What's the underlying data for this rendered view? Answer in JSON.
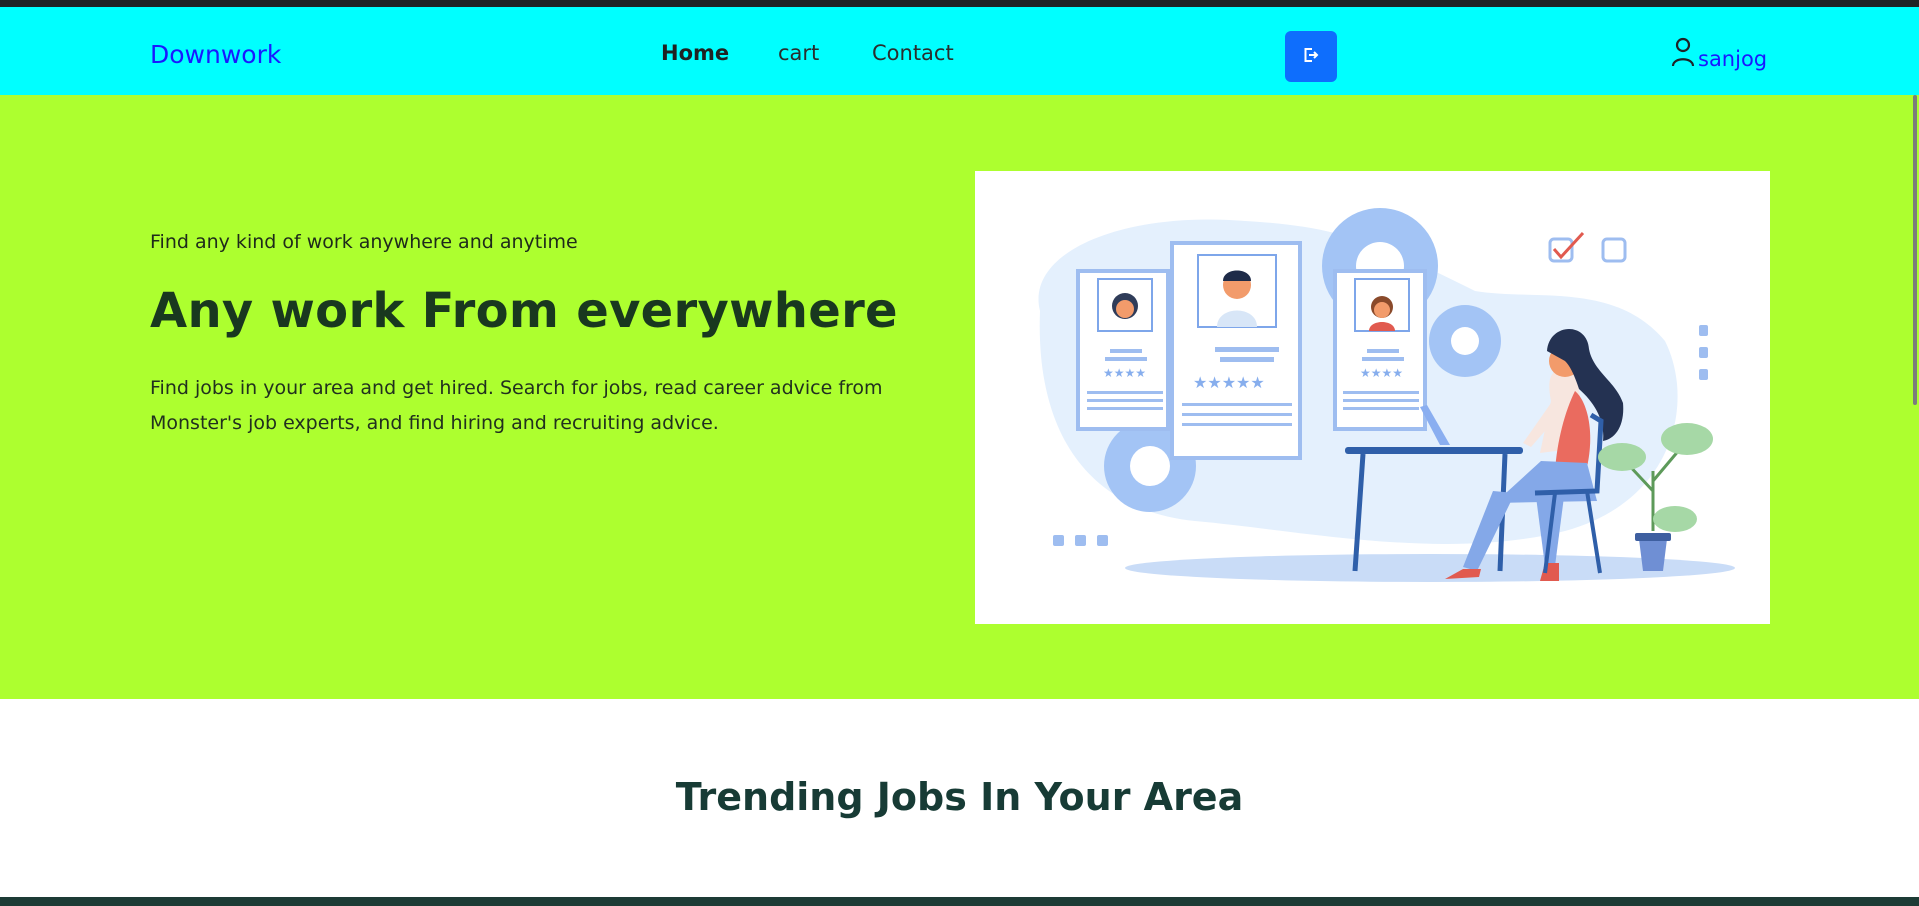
{
  "navbar": {
    "brand": "Downwork",
    "links": [
      {
        "label": "Home"
      },
      {
        "label": "cart"
      },
      {
        "label": "Contact"
      }
    ],
    "logout_icon": "logout-icon",
    "user_icon": "user-icon",
    "username": "sanjog"
  },
  "hero": {
    "kicker": "Find any kind of work anywhere and anytime",
    "title": "Any work From everywhere",
    "description": "Find jobs in your area and get hired. Search for jobs, read career advice from Monster's job experts, and find hiring and recruiting advice."
  },
  "trending": {
    "title": "Trending Jobs In Your Area"
  },
  "colors": {
    "navbar": "#00ffff",
    "hero": "#adff2f",
    "brand": "#1a19ff",
    "button": "#0e6efd",
    "footer": "#1d3b35"
  }
}
